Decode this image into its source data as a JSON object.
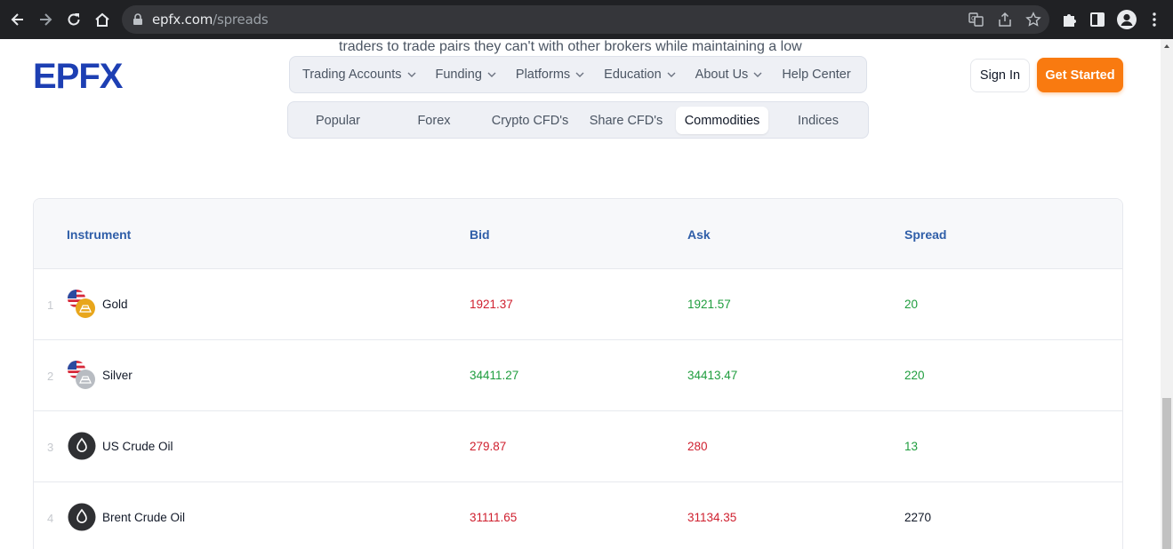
{
  "browser": {
    "url_host": "epfx.com",
    "url_path": "/spreads"
  },
  "page": {
    "cut_text": "traders to trade pairs they can't with other brokers while maintaining a low",
    "logo_text": "EPFX",
    "nav": [
      {
        "label": "Trading Accounts",
        "has_dropdown": true
      },
      {
        "label": "Funding",
        "has_dropdown": true
      },
      {
        "label": "Platforms",
        "has_dropdown": true
      },
      {
        "label": "Education",
        "has_dropdown": true
      },
      {
        "label": "About Us",
        "has_dropdown": true
      },
      {
        "label": "Help Center",
        "has_dropdown": false
      }
    ],
    "signin_label": "Sign In",
    "get_started_label": "Get Started",
    "tabs": [
      "Popular",
      "Forex",
      "Crypto CFD's",
      "Share CFD's",
      "Commodities",
      "Indices"
    ],
    "active_tab": "Commodities",
    "table": {
      "headers": [
        "Instrument",
        "Bid",
        "Ask",
        "Spread"
      ],
      "rows": [
        {
          "num": "1",
          "name": "Gold",
          "icon": "gold-icon",
          "bid": "1921.37",
          "ask": "1921.57",
          "spread": "20",
          "bid_color": "red",
          "ask_color": "green",
          "spread_color": "green"
        },
        {
          "num": "2",
          "name": "Silver",
          "icon": "silver-icon",
          "bid": "34411.27",
          "ask": "34413.47",
          "spread": "220",
          "bid_color": "green",
          "ask_color": "green",
          "spread_color": "green"
        },
        {
          "num": "3",
          "name": "US Crude Oil",
          "icon": "oil-drop-icon",
          "bid": "279.87",
          "ask": "280",
          "spread": "13",
          "bid_color": "red",
          "ask_color": "red",
          "spread_color": "green"
        },
        {
          "num": "4",
          "name": "Brent Crude Oil",
          "icon": "oil-drop-icon",
          "bid": "31111.65",
          "ask": "31134.35",
          "spread": "2270",
          "bid_color": "red",
          "ask_color": "red",
          "spread_color": "black"
        }
      ]
    }
  },
  "colors": {
    "brand_blue": "#1d3fb3",
    "accent_orange": "#f97a10",
    "header_blue": "#2f5ea8",
    "price_red": "#cf1f2e",
    "price_green": "#1f9d3e"
  }
}
